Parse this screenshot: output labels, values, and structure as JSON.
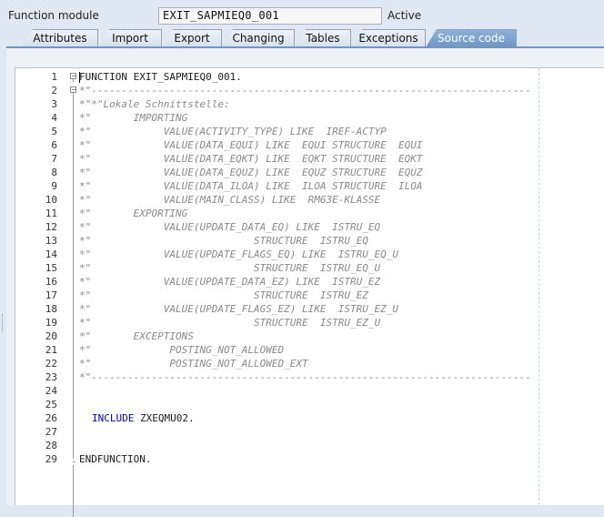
{
  "header": {
    "field_label": "Function module",
    "function_name": "EXIT_SAPMIEQ0_001",
    "status": "Active"
  },
  "tabs": [
    {
      "label": "Attributes"
    },
    {
      "label": "Import"
    },
    {
      "label": "Export"
    },
    {
      "label": "Changing"
    },
    {
      "label": "Tables"
    },
    {
      "label": "Exceptions"
    },
    {
      "label": "Source code"
    }
  ],
  "active_tab": "Source code",
  "editor": {
    "lines": [
      {
        "n": "1",
        "text": "FUNCTION EXIT_SAPMIEQ0_001.",
        "type": "code"
      },
      {
        "n": "2",
        "text": "*\"-------------------------------------------------------------------------",
        "type": "comment"
      },
      {
        "n": "3",
        "text": "*\"*\"Lokale Schnittstelle:",
        "type": "comment"
      },
      {
        "n": "4",
        "text": "*\"       IMPORTING",
        "type": "comment"
      },
      {
        "n": "5",
        "text": "*\"            VALUE(ACTIVITY_TYPE) LIKE  IREF-ACTYP",
        "type": "comment"
      },
      {
        "n": "6",
        "text": "*\"            VALUE(DATA_EQUI) LIKE  EQUI STRUCTURE  EQUI",
        "type": "comment"
      },
      {
        "n": "7",
        "text": "*\"            VALUE(DATA_EQKT) LIKE  EQKT STRUCTURE  EQKT",
        "type": "comment"
      },
      {
        "n": "8",
        "text": "*\"            VALUE(DATA_EQUZ) LIKE  EQUZ STRUCTURE  EQUZ",
        "type": "comment"
      },
      {
        "n": "9",
        "text": "*\"            VALUE(DATA_ILOA) LIKE  ILOA STRUCTURE  ILOA",
        "type": "comment"
      },
      {
        "n": "10",
        "text": "*\"            VALUE(MAIN_CLASS) LIKE  RM63E-KLASSE",
        "type": "comment"
      },
      {
        "n": "11",
        "text": "*\"       EXPORTING",
        "type": "comment"
      },
      {
        "n": "12",
        "text": "*\"            VALUE(UPDATE_DATA_EQ) LIKE  ISTRU_EQ",
        "type": "comment"
      },
      {
        "n": "13",
        "text": "*\"                           STRUCTURE  ISTRU_EQ",
        "type": "comment"
      },
      {
        "n": "14",
        "text": "*\"            VALUE(UPDATE_FLAGS_EQ) LIKE  ISTRU_EQ_U",
        "type": "comment"
      },
      {
        "n": "15",
        "text": "*\"                           STRUCTURE  ISTRU_EQ_U",
        "type": "comment"
      },
      {
        "n": "16",
        "text": "*\"            VALUE(UPDATE_DATA_EZ) LIKE  ISTRU_EZ",
        "type": "comment"
      },
      {
        "n": "17",
        "text": "*\"                           STRUCTURE  ISTRU_EZ",
        "type": "comment"
      },
      {
        "n": "18",
        "text": "*\"            VALUE(UPDATE_FLAGS_EZ) LIKE  ISTRU_EZ_U",
        "type": "comment"
      },
      {
        "n": "19",
        "text": "*\"                           STRUCTURE  ISTRU_EZ_U",
        "type": "comment"
      },
      {
        "n": "20",
        "text": "*\"       EXCEPTIONS",
        "type": "comment"
      },
      {
        "n": "21",
        "text": "*\"             POSTING_NOT_ALLOWED",
        "type": "comment"
      },
      {
        "n": "22",
        "text": "*\"             POSTING_NOT_ALLOWED_EXT",
        "type": "comment"
      },
      {
        "n": "23",
        "text": "*\"-------------------------------------------------------------------------",
        "type": "comment"
      },
      {
        "n": "24",
        "text": "",
        "type": "code"
      },
      {
        "n": "25",
        "text": "",
        "type": "code"
      },
      {
        "n": "26",
        "keyword": "INCLUDE",
        "rest": " ZXEQMU02.",
        "type": "include"
      },
      {
        "n": "27",
        "text": "",
        "type": "code"
      },
      {
        "n": "28",
        "text": "",
        "type": "code"
      },
      {
        "n": "29",
        "text": "ENDFUNCTION.",
        "type": "code"
      }
    ]
  },
  "colors": {
    "tab_active": "#6f97c6",
    "comment": "#8a8a8a",
    "keyword": "#0000a8"
  }
}
